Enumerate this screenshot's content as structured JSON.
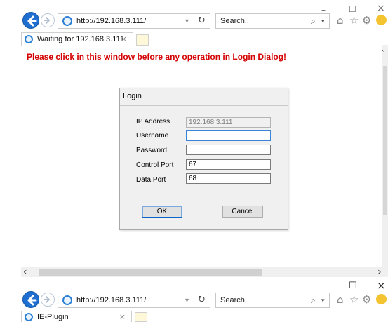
{
  "window1": {
    "url": "http://192.168.3.111/",
    "search_placeholder": "Search...",
    "tab_title": "Waiting for 192.168.3.111",
    "tab_close": "×",
    "minimize": "–",
    "maximize": "☐",
    "close": "×"
  },
  "page": {
    "warning": "Please click in this window before any operation in Login Dialog!"
  },
  "login_dialog": {
    "title": "Login",
    "fields": [
      {
        "label": "IP Address",
        "value": "192.168.3.111"
      },
      {
        "label": "Username",
        "value": ""
      },
      {
        "label": "Password",
        "value": ""
      },
      {
        "label": "Control Port",
        "value": "67"
      },
      {
        "label": "Data Port",
        "value": "68"
      }
    ],
    "ok_label": "OK",
    "cancel_label": "Cancel"
  },
  "window2": {
    "url": "http://192.168.3.111/",
    "search_placeholder": "Search...",
    "tab_title": "IE-Plugin",
    "tab_close": "×",
    "minimize": "–",
    "maximize": "☐",
    "close": "×"
  },
  "icons": {
    "back": "back-arrow-icon",
    "forward": "forward-arrow-icon",
    "refresh": "refresh-icon",
    "search": "search-icon",
    "home": "home-icon",
    "favorites": "star-icon",
    "settings": "gear-icon",
    "smiley": "smiley-icon"
  },
  "colors": {
    "warning": "#d40000",
    "ie_blue": "#1e6fd0",
    "focus_border": "#3c82d6"
  }
}
